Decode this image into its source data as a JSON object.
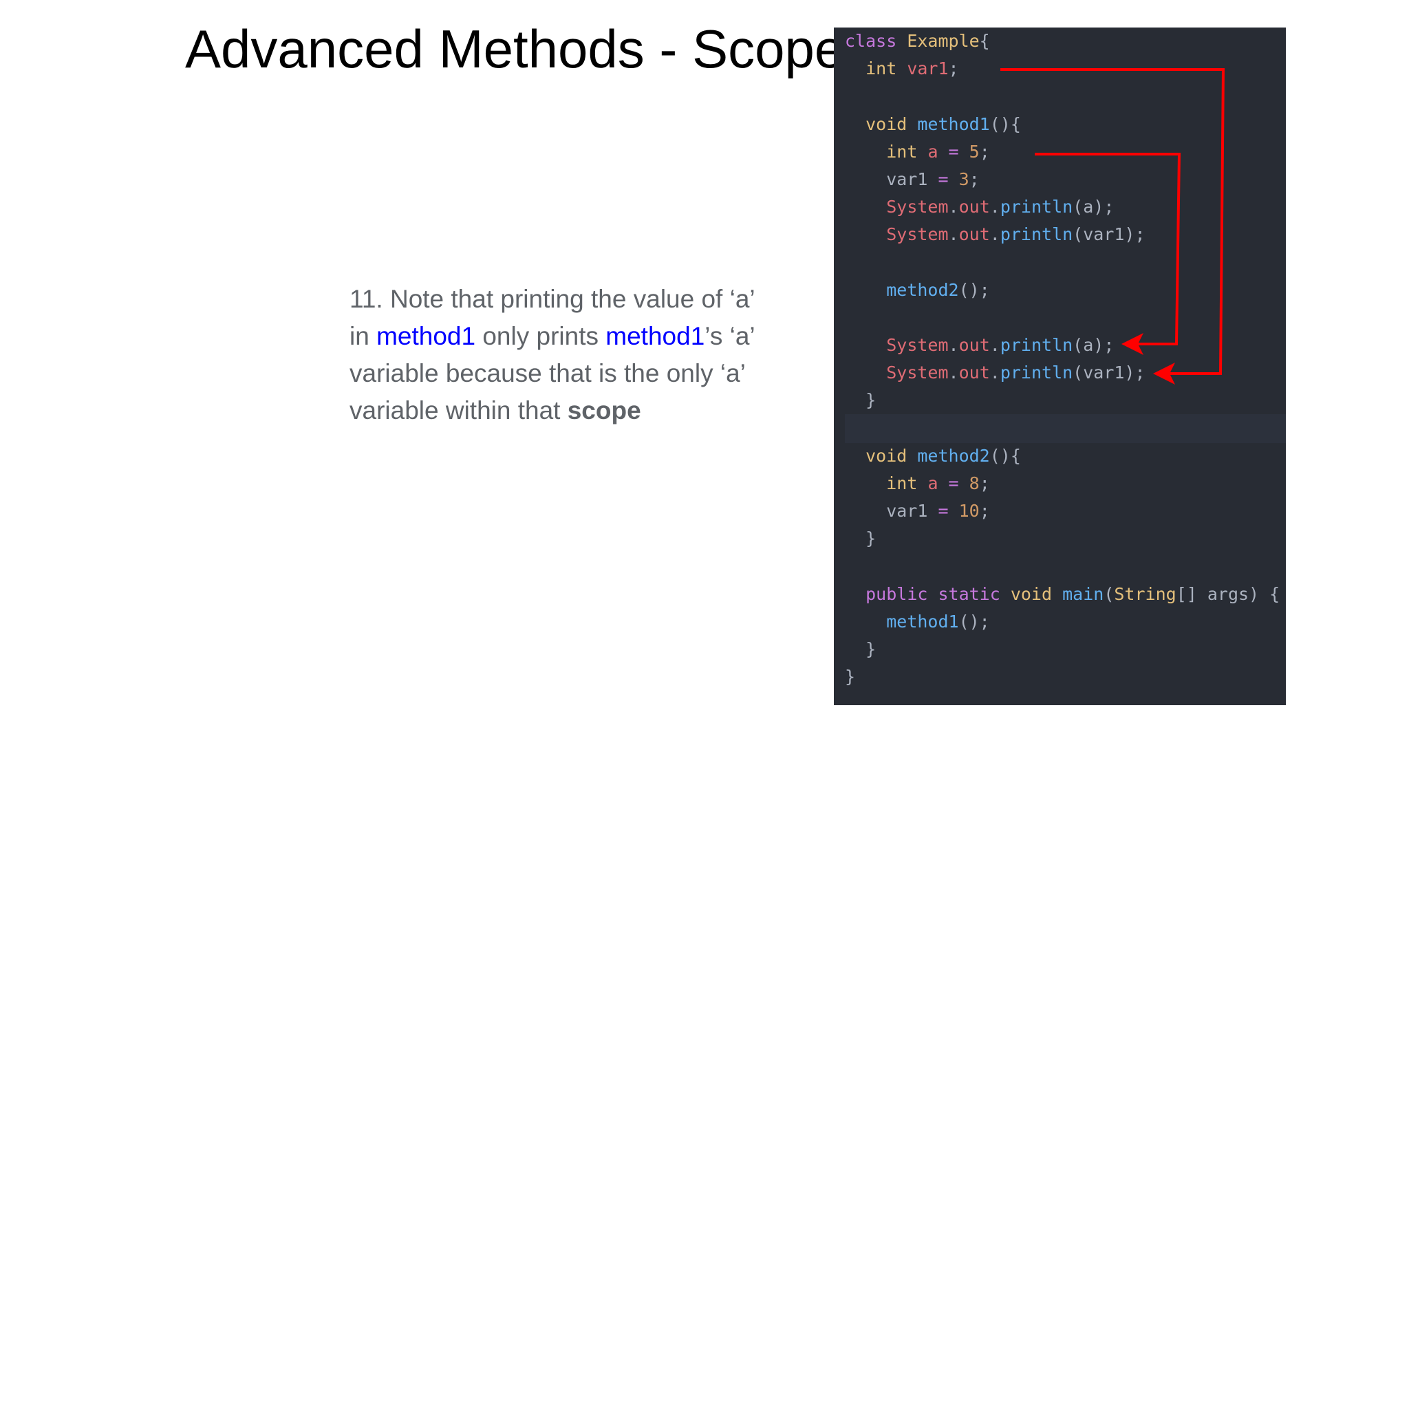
{
  "slide": {
    "title": "Advanced Methods - Scope",
    "note": {
      "part1": "11. Note that printing the value of ‘a’ in ",
      "link1": "method1",
      "part2": " only prints ",
      "link2": "method1",
      "part3": "’s ‘a’ variable because that is the only ‘a’ variable within that ",
      "bold": "scope"
    }
  },
  "code": {
    "lines": [
      [
        [
          "k",
          "class "
        ],
        [
          "t",
          "Example"
        ],
        [
          "p",
          "{"
        ]
      ],
      [
        [
          "p",
          "  "
        ],
        [
          "t",
          "int "
        ],
        [
          "v",
          "var1"
        ],
        [
          "p",
          ";"
        ]
      ],
      [],
      [
        [
          "p",
          "  "
        ],
        [
          "t",
          "void "
        ],
        [
          "f",
          "method1"
        ],
        [
          "p",
          "(){"
        ]
      ],
      [
        [
          "p",
          "    "
        ],
        [
          "t",
          "int "
        ],
        [
          "v",
          "a "
        ],
        [
          "k",
          "= "
        ],
        [
          "n",
          "5"
        ],
        [
          "p",
          ";"
        ]
      ],
      [
        [
          "p",
          "    var1 "
        ],
        [
          "k",
          "= "
        ],
        [
          "n",
          "3"
        ],
        [
          "p",
          ";"
        ]
      ],
      [
        [
          "p",
          "    "
        ],
        [
          "v",
          "System"
        ],
        [
          "p",
          "."
        ],
        [
          "v",
          "out"
        ],
        [
          "p",
          "."
        ],
        [
          "f",
          "println"
        ],
        [
          "p",
          "(a);"
        ]
      ],
      [
        [
          "p",
          "    "
        ],
        [
          "v",
          "System"
        ],
        [
          "p",
          "."
        ],
        [
          "v",
          "out"
        ],
        [
          "p",
          "."
        ],
        [
          "f",
          "println"
        ],
        [
          "p",
          "(var1);"
        ]
      ],
      [],
      [
        [
          "p",
          "    "
        ],
        [
          "f",
          "method2"
        ],
        [
          "p",
          "();"
        ]
      ],
      [],
      [
        [
          "p",
          "    "
        ],
        [
          "v",
          "System"
        ],
        [
          "p",
          "."
        ],
        [
          "v",
          "out"
        ],
        [
          "p",
          "."
        ],
        [
          "f",
          "println"
        ],
        [
          "p",
          "(a);"
        ]
      ],
      [
        [
          "p",
          "    "
        ],
        [
          "v",
          "System"
        ],
        [
          "p",
          "."
        ],
        [
          "v",
          "out"
        ],
        [
          "p",
          "."
        ],
        [
          "f",
          "println"
        ],
        [
          "p",
          "(var1);"
        ]
      ],
      [
        [
          "p",
          "  }"
        ]
      ],
      [],
      [
        [
          "p",
          "  "
        ],
        [
          "t",
          "void "
        ],
        [
          "f",
          "method2"
        ],
        [
          "p",
          "(){"
        ]
      ],
      [
        [
          "p",
          "    "
        ],
        [
          "t",
          "int "
        ],
        [
          "v",
          "a "
        ],
        [
          "k",
          "= "
        ],
        [
          "n",
          "8"
        ],
        [
          "p",
          ";"
        ]
      ],
      [
        [
          "p",
          "    var1 "
        ],
        [
          "k",
          "= "
        ],
        [
          "n",
          "10"
        ],
        [
          "p",
          ";"
        ]
      ],
      [
        [
          "p",
          "  }"
        ]
      ],
      [],
      [
        [
          "p",
          "  "
        ],
        [
          "k",
          "public static "
        ],
        [
          "t",
          "void "
        ],
        [
          "f",
          "main"
        ],
        [
          "p",
          "("
        ],
        [
          "t",
          "String"
        ],
        [
          "p",
          "[] args) {"
        ]
      ],
      [
        [
          "p",
          "    "
        ],
        [
          "f",
          "method1"
        ],
        [
          "p",
          "();"
        ]
      ],
      [
        [
          "p",
          "  }"
        ]
      ],
      [
        [
          "p",
          "}"
        ]
      ]
    ]
  },
  "colors": {
    "arrow": "#ff0000",
    "code_background": "#282c34",
    "link": "#0000ff"
  }
}
